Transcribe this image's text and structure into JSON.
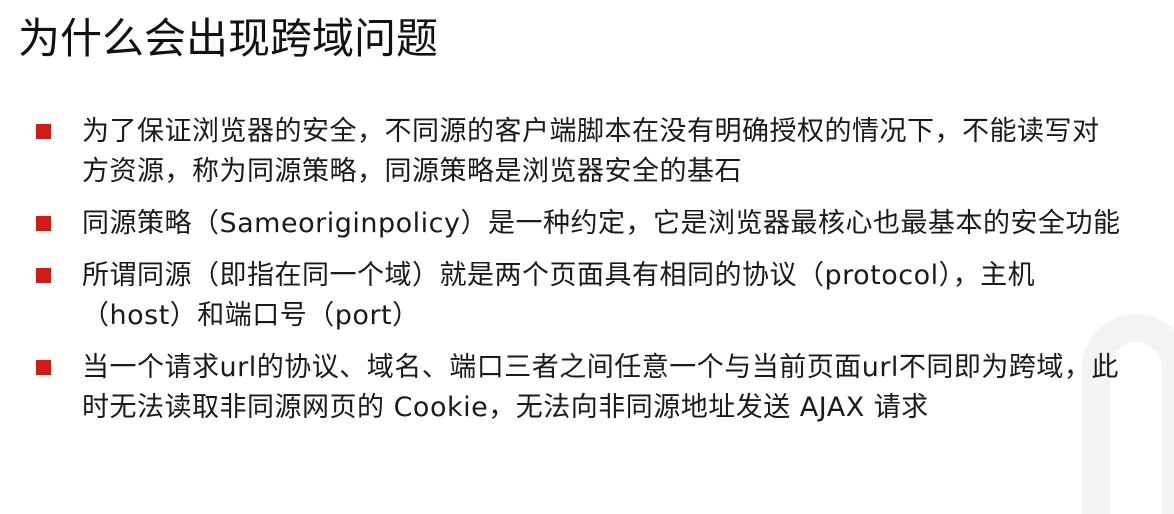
{
  "slide": {
    "title": "为什么会出现跨域问题",
    "bullets": [
      {
        "text": "为了保证浏览器的安全，不同源的客户端脚本在没有明确授权的情况下，不能读写对方资源，称为同源策略，同源策略是浏览器安全的基石"
      },
      {
        "text": "同源策略（Sameoriginpolicy）是一种约定，它是浏览器最核心也最基本的安全功能"
      },
      {
        "text": "所谓同源（即指在同一个域）就是两个页面具有相同的协议（protocol），主机（host）和端口号（port）"
      },
      {
        "text": "当一个请求url的协议、域名、端口三者之间任意一个与当前页面url不同即为跨域，此时无法读取非同源网页的 Cookie，无法向非同源地址发送 AJAX 请求"
      }
    ]
  },
  "colors": {
    "bullet_marker": "#cc1b1b",
    "text": "#1a1a1a",
    "watermark": "#f3f3f3"
  }
}
